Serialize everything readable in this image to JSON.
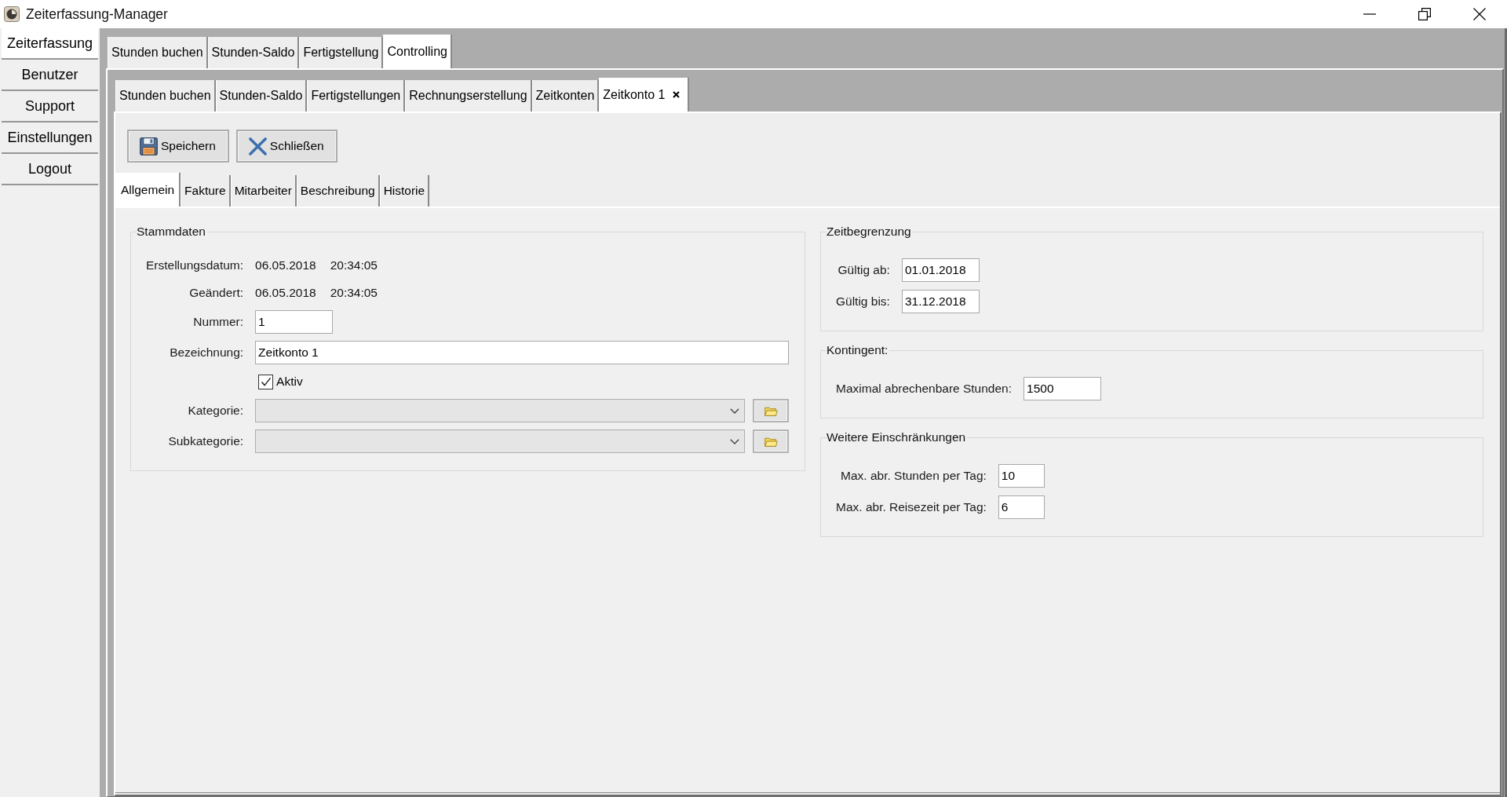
{
  "window": {
    "title": "Zeiterfassung-Manager"
  },
  "sidebar": {
    "items": [
      {
        "label": "Zeiterfassung",
        "selected": true
      },
      {
        "label": "Benutzer",
        "selected": false
      },
      {
        "label": "Support",
        "selected": false
      },
      {
        "label": "Einstellungen",
        "selected": false
      },
      {
        "label": "Logout",
        "selected": false
      }
    ]
  },
  "main_tabs": [
    {
      "label": "Stunden buchen",
      "selected": false
    },
    {
      "label": "Stunden-Saldo",
      "selected": false
    },
    {
      "label": "Fertigstellung",
      "selected": false
    },
    {
      "label": "Controlling",
      "selected": true
    }
  ],
  "controlling_tabs": [
    {
      "label": "Stunden buchen",
      "selected": false,
      "closable": false
    },
    {
      "label": "Stunden-Saldo",
      "selected": false,
      "closable": false
    },
    {
      "label": "Fertigstellungen",
      "selected": false,
      "closable": false
    },
    {
      "label": "Rechnungserstellung",
      "selected": false,
      "closable": false
    },
    {
      "label": "Zeitkonten",
      "selected": false,
      "closable": false
    },
    {
      "label": "Zeitkonto 1",
      "selected": true,
      "closable": true
    }
  ],
  "toolbar": {
    "buttons": [
      {
        "label": "Speichern",
        "kind": "save"
      },
      {
        "label": "Schließen",
        "kind": "close"
      }
    ]
  },
  "detail_tabs": [
    {
      "label": "Allgemein",
      "selected": true
    },
    {
      "label": "Fakture",
      "selected": false
    },
    {
      "label": "Mitarbeiter",
      "selected": false
    },
    {
      "label": "Beschreibung",
      "selected": false
    },
    {
      "label": "Historie",
      "selected": false
    }
  ],
  "form": {
    "left": [
      {
        "title": "Stammdaten",
        "fields": [
          {
            "kind": "info",
            "label": "Erstellungsdatum:",
            "date": "06.05.2018",
            "time": "20:34:05"
          },
          {
            "kind": "info",
            "label": "Geändert:",
            "date": "06.05.2018",
            "time": "20:34:05"
          },
          {
            "kind": "input",
            "label": "Nummer:",
            "value": "1"
          },
          {
            "kind": "wide",
            "label": "Bezeichnung:",
            "value": "Zeitkonto 1"
          },
          {
            "kind": "checkbox",
            "label": "Aktiv",
            "checked": true
          },
          {
            "kind": "combo",
            "label": "Kategorie:"
          },
          {
            "kind": "combo",
            "label": "Subkategorie:"
          }
        ]
      }
    ],
    "right": [
      {
        "title": "Zeitbegrenzung",
        "fields": [
          {
            "kind": "input",
            "label": "Gültig ab:",
            "value": "01.01.2018"
          },
          {
            "kind": "input",
            "label": "Gültig bis:",
            "value": "31.12.2018"
          }
        ]
      },
      {
        "title": "Kontingent:",
        "fields": [
          {
            "kind": "input",
            "label": "Maximal abrechenbare Stunden:",
            "value": "1500"
          }
        ]
      },
      {
        "title": "Weitere Einschränkungen",
        "fields": [
          {
            "kind": "small",
            "label": "Max. abr. Stunden per Tag:",
            "value": "10"
          },
          {
            "kind": "small",
            "label": "Max. abr. Reisezeit per Tag:",
            "value": "6"
          }
        ]
      }
    ]
  }
}
